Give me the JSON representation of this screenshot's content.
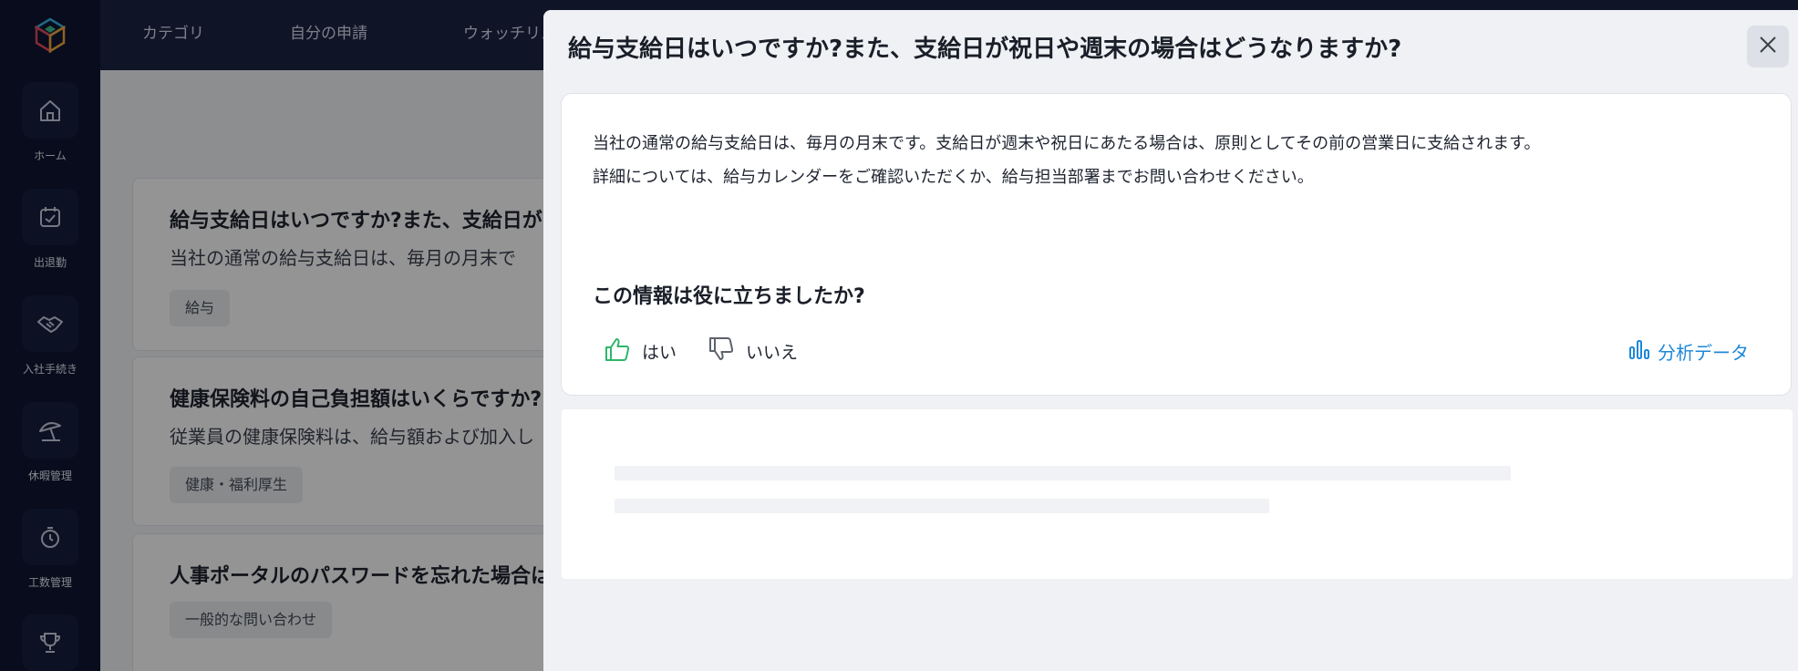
{
  "sidebar": {
    "items": [
      {
        "label": "ホーム",
        "icon": "home-icon"
      },
      {
        "label": "出退勤",
        "icon": "calendar-check-icon"
      },
      {
        "label": "入社手続き",
        "icon": "handshake-icon"
      },
      {
        "label": "休暇管理",
        "icon": "beach-umbrella-icon"
      },
      {
        "label": "工数管理",
        "icon": "stopwatch-icon"
      },
      {
        "label": "",
        "icon": "trophy-icon"
      }
    ]
  },
  "topnav": {
    "items": [
      "カテゴリ",
      "自分の申請",
      "ウォッチリス"
    ]
  },
  "faq_list": [
    {
      "title": "給与支給日はいつですか?また、支給日が",
      "excerpt": "当社の通常の給与支給日は、毎月の月末で",
      "tag": "給与"
    },
    {
      "title": "健康保険料の自己負担額はいくらですか?",
      "excerpt": "従業員の健康保険料は、給与額および加入し",
      "tag": "健康・福利厚生"
    },
    {
      "title": "人事ポータルのパスワードを忘れた場合は",
      "excerpt": "",
      "tag": "一般的な問い合わせ"
    }
  ],
  "modal": {
    "title": "給与支給日はいつですか?また、支給日が祝日や週末の場合はどうなりますか?",
    "answer_lines": [
      "当社の通常の給与支給日は、毎月の月末です。支給日が週末や祝日にあたる場合は、原則としてその前の営業日に支給されます。",
      "詳細については、給与カレンダーをご確認いただくか、給与担当部署までお問い合わせください。"
    ],
    "feedback_question": "この情報は役に立ちましたか?",
    "yes_label": "はい",
    "no_label": "いいえ",
    "analytics_label": "分析データ"
  },
  "colors": {
    "sidebar_bg": "#0f1631",
    "accent_blue": "#1e88d8",
    "thumbs_up_green": "#2fb56a"
  }
}
